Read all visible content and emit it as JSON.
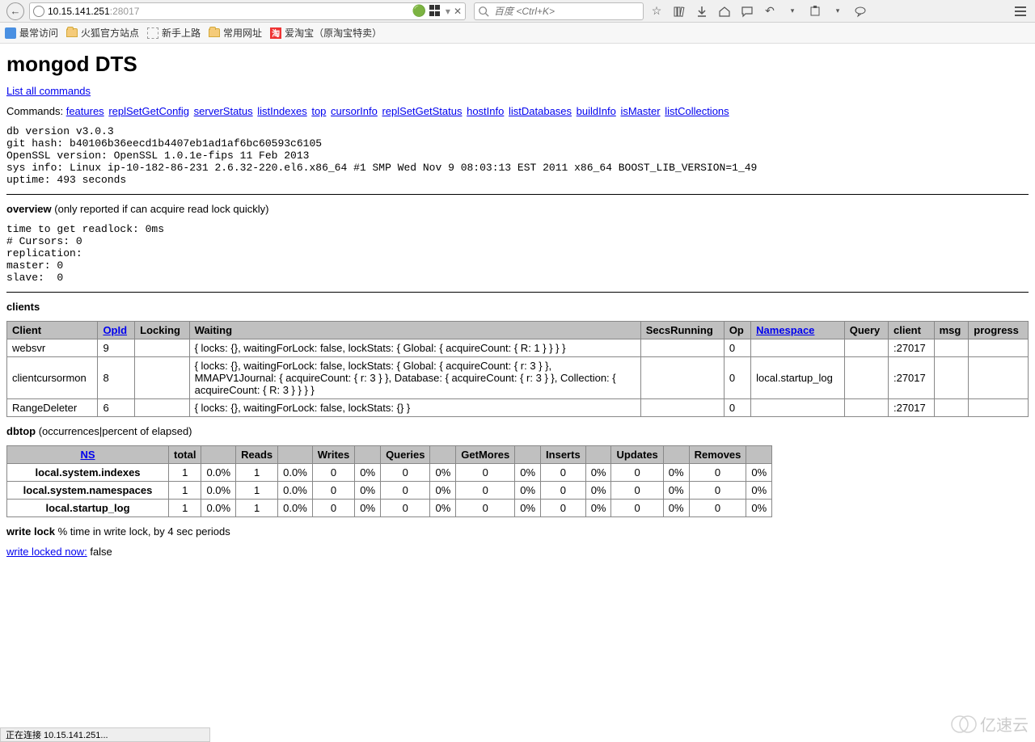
{
  "browser": {
    "url_host": "10.15.141.251",
    "url_port": ":28017",
    "search_placeholder": "百度 <Ctrl+K>",
    "dropdown_glyph": "▾",
    "close_glyph": "✕"
  },
  "bookmarks": {
    "most_visited": "最常访问",
    "firefox_official": "火狐官方站点",
    "getting_started": "新手上路",
    "common_urls": "常用网址",
    "aitaobao": "爱淘宝（原淘宝特卖）",
    "aitaobao_badge": "淘"
  },
  "page": {
    "title": "mongod DTS",
    "list_all_commands": "List all commands",
    "commands_label": "Commands: ",
    "commands": [
      "features",
      "replSetGetConfig",
      "serverStatus",
      "listIndexes",
      "top",
      "cursorInfo",
      "replSetGetStatus",
      "hostInfo",
      "listDatabases",
      "buildInfo",
      "isMaster",
      "listCollections"
    ],
    "sysinfo": "db version v3.0.3\ngit hash: b40106b36eecd1b4407eb1ad1af6bc60593c6105\nOpenSSL version: OpenSSL 1.0.1e-fips 11 Feb 2013\nsys info: Linux ip-10-182-86-231 2.6.32-220.el6.x86_64 #1 SMP Wed Nov 9 08:03:13 EST 2011 x86_64 BOOST_LIB_VERSION=1_49\nuptime: 493 seconds",
    "overview_label": "overview",
    "overview_note": " (only reported if can acquire read lock quickly)",
    "overview_block": "time to get readlock: 0ms\n# Cursors: 0\nreplication: \nmaster: 0\nslave:  0",
    "clients_label": "clients",
    "clients_headers": {
      "client": "Client",
      "opid": "OpId",
      "locking": "Locking",
      "waiting": "Waiting",
      "secs": "SecsRunning",
      "op": "Op",
      "ns": "Namespace",
      "query": "Query",
      "cclient": "client",
      "msg": "msg",
      "progress": "progress"
    },
    "clients_rows": [
      {
        "client": "websvr",
        "opid": "9",
        "locking": "",
        "waiting": "{ locks: {}, waitingForLock: false, lockStats: { Global: { acquireCount: { R: 1 } } } }",
        "secs": "",
        "op": "0",
        "ns": "",
        "query": "",
        "cclient": ":27017",
        "msg": "",
        "progress": ""
      },
      {
        "client": "clientcursormon",
        "opid": "8",
        "locking": "",
        "waiting": "{ locks: {}, waitingForLock: false, lockStats: { Global: { acquireCount: { r: 3 } }, MMAPV1Journal: { acquireCount: { r: 3 } }, Database: { acquireCount: { r: 3 } }, Collection: { acquireCount: { R: 3 } } } }",
        "secs": "",
        "op": "0",
        "ns": "local.startup_log",
        "query": "",
        "cclient": ":27017",
        "msg": "",
        "progress": ""
      },
      {
        "client": "RangeDeleter",
        "opid": "6",
        "locking": "",
        "waiting": "{ locks: {}, waitingForLock: false, lockStats: {} }",
        "secs": "",
        "op": "0",
        "ns": "",
        "query": "",
        "cclient": ":27017",
        "msg": "",
        "progress": ""
      }
    ],
    "dbtop_label": "dbtop",
    "dbtop_note": " (occurrences|percent of elapsed)",
    "dbtop_headers": [
      "NS",
      "total",
      "",
      "Reads",
      "",
      "Writes",
      "",
      "Queries",
      "",
      "GetMores",
      "",
      "Inserts",
      "",
      "Updates",
      "",
      "Removes",
      ""
    ],
    "dbtop_rows": [
      {
        "ns": "local.system.indexes",
        "cells": [
          "1",
          "0.0%",
          "1",
          "0.0%",
          "0",
          "0%",
          "0",
          "0%",
          "0",
          "0%",
          "0",
          "0%",
          "0",
          "0%",
          "0",
          "0%"
        ]
      },
      {
        "ns": "local.system.namespaces",
        "cells": [
          "1",
          "0.0%",
          "1",
          "0.0%",
          "0",
          "0%",
          "0",
          "0%",
          "0",
          "0%",
          "0",
          "0%",
          "0",
          "0%",
          "0",
          "0%"
        ]
      },
      {
        "ns": "local.startup_log",
        "cells": [
          "1",
          "0.0%",
          "1",
          "0.0%",
          "0",
          "0%",
          "0",
          "0%",
          "0",
          "0%",
          "0",
          "0%",
          "0",
          "0%",
          "0",
          "0%"
        ]
      }
    ],
    "writelock_label": "write lock",
    "writelock_note": " % time in write lock, by 4 sec periods",
    "writelock_link": "write locked now:",
    "writelock_value": " false"
  },
  "status": {
    "text": "正在连接 10.15.141.251..."
  },
  "watermark": {
    "text": "亿速云"
  }
}
